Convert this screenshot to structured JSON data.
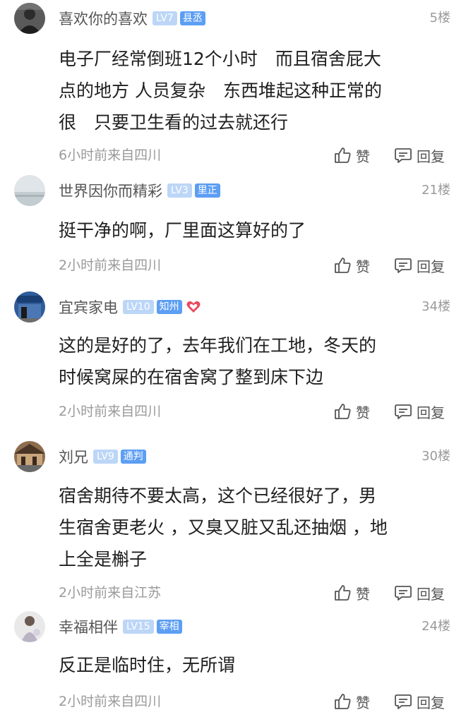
{
  "comments": [
    {
      "username": "喜欢你的喜欢",
      "level": "LV7",
      "title": "县丞",
      "floor": "5楼",
      "lines": [
        "电子厂经常倒班12个小时　而且宿舍屁大",
        "点的地方 人员复杂　东西堆起这种正常的",
        "很　只要卫生看的过去就还行"
      ],
      "meta": "6小时前来自四川",
      "like_label": "赞",
      "reply_label": "回复"
    },
    {
      "username": "世界因你而精彩",
      "level": "LV3",
      "title": "里正",
      "floor": "21楼",
      "lines": [
        "挺干净的啊，厂里面这算好的了"
      ],
      "meta": "2小时前来自四川",
      "like_label": "赞",
      "reply_label": "回复"
    },
    {
      "username": "宜宾家电",
      "level": "LV10",
      "title": "知州",
      "floor": "34楼",
      "lines": [
        "这的是好的了，去年我们在工地，冬天的",
        "时候窝屎的在宿舍窝了整到床下边"
      ],
      "meta": "2小时前来自四川",
      "like_label": "赞",
      "reply_label": "回复"
    },
    {
      "username": "刘兄",
      "level": "LV9",
      "title": "通判",
      "floor": "30楼",
      "lines": [
        "宿舍期待不要太高，这个已经很好了，男",
        "生宿舍更老火 ，又臭又脏又乱还抽烟 ，地",
        "上全是槲子"
      ],
      "meta": "2小时前来自江苏",
      "like_label": "赞",
      "reply_label": "回复"
    },
    {
      "username": "幸福相伴",
      "level": "LV15",
      "title": "宰相",
      "floor": "24楼",
      "lines": [
        "反正是临时住，无所谓"
      ],
      "meta": "2小时前来自四川",
      "like_label": "赞",
      "reply_label": "回复"
    }
  ],
  "icons": {
    "like": "thumbs-up-icon",
    "reply": "reply-icon",
    "badge": "heart-badge-icon"
  }
}
